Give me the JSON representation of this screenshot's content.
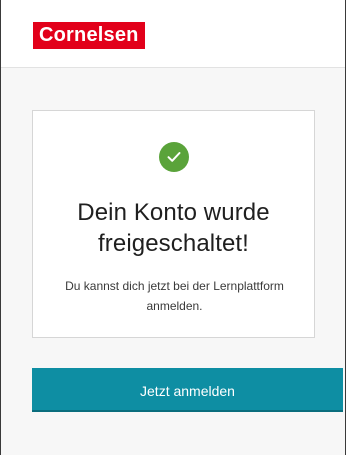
{
  "header": {
    "logo_text": "Cornelsen"
  },
  "card": {
    "status_icon": "check-circle-icon",
    "title_line1": "Dein Konto wurde",
    "title_line2": "freigeschaltet!",
    "description_line1": "Du kannst dich jetzt bei der Lernplattform",
    "description_line2": "anmelden."
  },
  "actions": {
    "login_label": "Jetzt anmelden"
  },
  "colors": {
    "brand_red": "#e2001a",
    "success_green": "#5aa33a",
    "button_teal": "#0e8ea3"
  }
}
